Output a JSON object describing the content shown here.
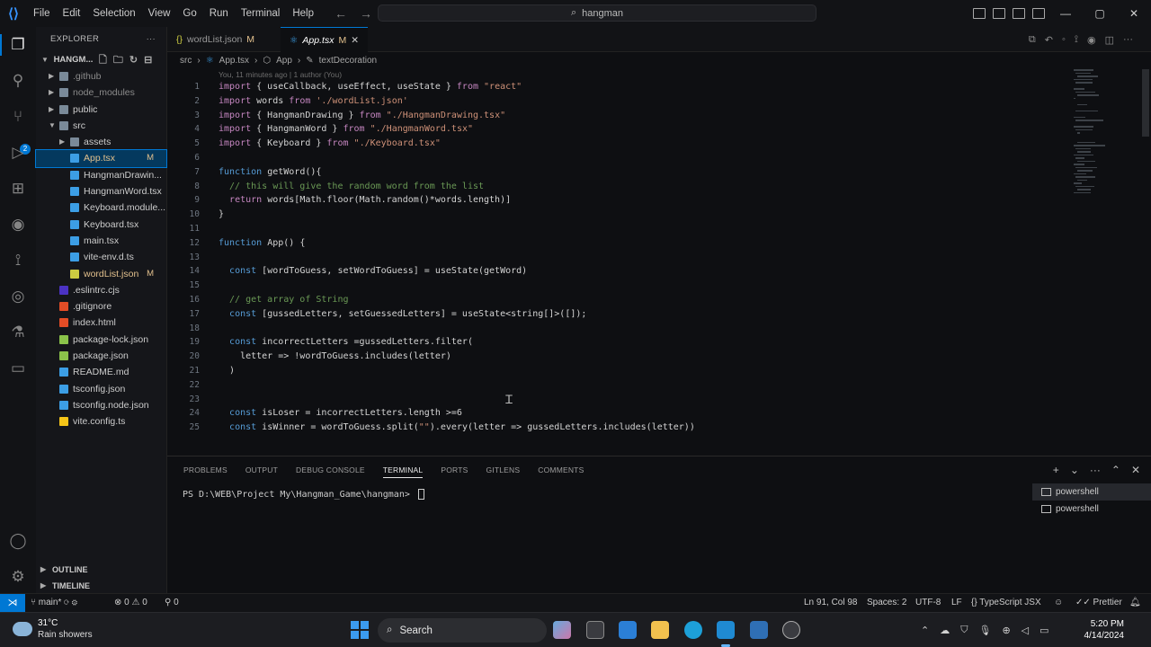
{
  "titlebar": {
    "menu": [
      "File",
      "Edit",
      "Selection",
      "View",
      "Go",
      "Run",
      "Terminal",
      "Help"
    ],
    "search": "hangman"
  },
  "explorer": {
    "title": "EXPLORER",
    "project": "HANGM...",
    "items": [
      {
        "label": ".github",
        "indent": 1,
        "folder": true,
        "color": "#8b8b8b",
        "mark": ""
      },
      {
        "label": "node_modules",
        "indent": 1,
        "folder": true,
        "color": "#8b8b8b",
        "mark": ""
      },
      {
        "label": "public",
        "indent": 1,
        "folder": true,
        "color": "#cccccc",
        "mark": ""
      },
      {
        "label": "src",
        "indent": 1,
        "folder": true,
        "open": true,
        "color": "#cccccc",
        "mark": ""
      },
      {
        "label": "assets",
        "indent": 2,
        "folder": true,
        "color": "#cccccc",
        "mark": ""
      },
      {
        "label": "App.tsx",
        "indent": 2,
        "icon": "#3c9ee5",
        "color": "#e2c08d",
        "mark": "M",
        "selected": true
      },
      {
        "label": "HangmanDrawin...",
        "indent": 2,
        "icon": "#3c9ee5",
        "color": "#cccccc",
        "mark": ""
      },
      {
        "label": "HangmanWord.tsx",
        "indent": 2,
        "icon": "#3c9ee5",
        "color": "#cccccc",
        "mark": ""
      },
      {
        "label": "Keyboard.module...",
        "indent": 2,
        "icon": "#3c9ee5",
        "color": "#cccccc",
        "mark": ""
      },
      {
        "label": "Keyboard.tsx",
        "indent": 2,
        "icon": "#3c9ee5",
        "color": "#cccccc",
        "mark": ""
      },
      {
        "label": "main.tsx",
        "indent": 2,
        "icon": "#3c9ee5",
        "color": "#cccccc",
        "mark": ""
      },
      {
        "label": "vite-env.d.ts",
        "indent": 2,
        "icon": "#3c9ee5",
        "color": "#cccccc",
        "mark": ""
      },
      {
        "label": "wordList.json",
        "indent": 2,
        "icon": "#cbcb41",
        "color": "#e2c08d",
        "mark": "M"
      },
      {
        "label": ".eslintrc.cjs",
        "indent": 1,
        "icon": "#4b32c3",
        "color": "#cccccc",
        "mark": ""
      },
      {
        "label": ".gitignore",
        "indent": 1,
        "icon": "#e44d26",
        "color": "#cccccc",
        "mark": ""
      },
      {
        "label": "index.html",
        "indent": 1,
        "icon": "#e44d26",
        "color": "#cccccc",
        "mark": ""
      },
      {
        "label": "package-lock.json",
        "indent": 1,
        "icon": "#8bc34a",
        "color": "#cccccc",
        "mark": ""
      },
      {
        "label": "package.json",
        "indent": 1,
        "icon": "#8bc34a",
        "color": "#cccccc",
        "mark": ""
      },
      {
        "label": "README.md",
        "indent": 1,
        "icon": "#3c9ee5",
        "color": "#cccccc",
        "mark": ""
      },
      {
        "label": "tsconfig.json",
        "indent": 1,
        "icon": "#3c9ee5",
        "color": "#cccccc",
        "mark": ""
      },
      {
        "label": "tsconfig.node.json",
        "indent": 1,
        "icon": "#3c9ee5",
        "color": "#cccccc",
        "mark": ""
      },
      {
        "label": "vite.config.ts",
        "indent": 1,
        "icon": "#f5c518",
        "color": "#cccccc",
        "mark": ""
      }
    ],
    "outline": "OUTLINE",
    "timeline": "TIMELINE"
  },
  "tabs": [
    {
      "label": "wordList.json",
      "modified": "M",
      "active": false
    },
    {
      "label": "App.tsx",
      "modified": "M",
      "active": true
    }
  ],
  "breadcrumb": [
    "src",
    "App.tsx",
    "App",
    "textDecoration"
  ],
  "blame": "You, 11 minutes ago | 1 author (You)",
  "code": [
    {
      "n": 1,
      "t": "import { useCallback, useEffect, useState } from \"react\""
    },
    {
      "n": 2,
      "t": "import words from './wordList.json'"
    },
    {
      "n": 3,
      "t": "import { HangmanDrawing } from \"./HangmanDrawing.tsx\""
    },
    {
      "n": 4,
      "t": "import { HangmanWord } from \"./HangmanWord.tsx\""
    },
    {
      "n": 5,
      "t": "import { Keyboard } from \"./Keyboard.tsx\""
    },
    {
      "n": 6,
      "t": ""
    },
    {
      "n": 7,
      "t": "function getWord(){"
    },
    {
      "n": 8,
      "t": "  // this will give the random word from the list"
    },
    {
      "n": 9,
      "t": "  return words[Math.floor(Math.random()*words.length)]"
    },
    {
      "n": 10,
      "t": "}"
    },
    {
      "n": 11,
      "t": ""
    },
    {
      "n": 12,
      "t": "function App() {"
    },
    {
      "n": 13,
      "t": ""
    },
    {
      "n": 14,
      "t": "  const [wordToGuess, setWordToGuess] = useState(getWord)"
    },
    {
      "n": 15,
      "t": ""
    },
    {
      "n": 16,
      "t": "  // get array of String"
    },
    {
      "n": 17,
      "t": "  const [gussedLetters, setGuessedLetters] = useState<string[]>([]);"
    },
    {
      "n": 18,
      "t": ""
    },
    {
      "n": 19,
      "t": "  const incorrectLetters =gussedLetters.filter("
    },
    {
      "n": 20,
      "t": "    letter => !wordToGuess.includes(letter)"
    },
    {
      "n": 21,
      "t": "  )"
    },
    {
      "n": 22,
      "t": ""
    },
    {
      "n": 23,
      "t": ""
    },
    {
      "n": 24,
      "t": "  const isLoser = incorrectLetters.length >=6"
    },
    {
      "n": 25,
      "t": "  const isWinner = wordToGuess.split(\"\").every(letter => gussedLetters.includes(letter))"
    }
  ],
  "panel": {
    "tabs": [
      "PROBLEMS",
      "OUTPUT",
      "DEBUG CONSOLE",
      "TERMINAL",
      "PORTS",
      "GITLENS",
      "COMMENTS"
    ],
    "active_tab": "TERMINAL",
    "prompt": "PS D:\\WEB\\Project My\\Hangman_Game\\hangman> ",
    "terminals": [
      "powershell",
      "powershell"
    ]
  },
  "statusbar": {
    "branch": "main*",
    "problems": "⊗ 0 ⚠ 0",
    "ports": "⚲ 0",
    "position": "Ln 91, Col 98",
    "spaces": "Spaces: 2",
    "encoding": "UTF-8",
    "eol": "LF",
    "language": "TypeScript JSX",
    "prettier": "Prettier"
  },
  "taskbar": {
    "temp": "31°C",
    "weather": "Rain showers",
    "search": "Search",
    "time": "5:20 PM",
    "date": "4/14/2024"
  }
}
